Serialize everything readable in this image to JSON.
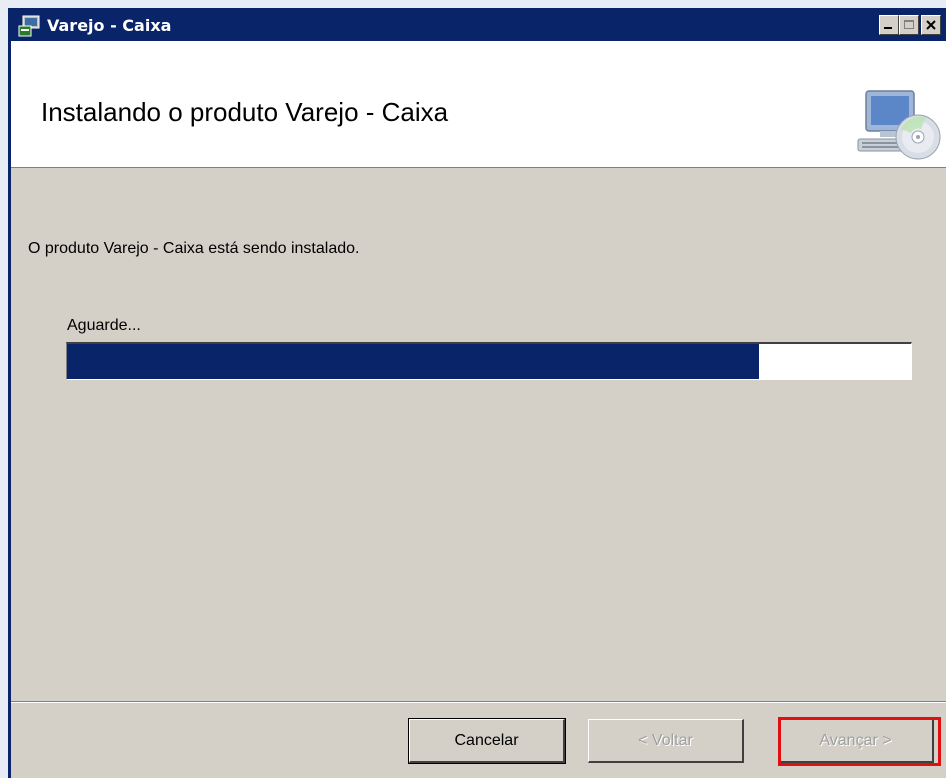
{
  "window": {
    "title": "Varejo - Caixa",
    "app_icon": "installer-icon"
  },
  "header": {
    "title": "Instalando o produto Varejo - Caixa",
    "icon": "computer-cd-icon"
  },
  "body": {
    "status_text": "O produto Varejo - Caixa está sendo instalado.",
    "wait_label": "Aguarde...",
    "progress": 0.82
  },
  "buttons": {
    "cancel": "Cancelar",
    "back": "< Voltar",
    "next": "Avançar >"
  },
  "colors": {
    "titlebar": "#0a246a",
    "progress_fill": "#0a246a",
    "highlight": "#e01010",
    "dialog_face": "#d4d0c8"
  }
}
